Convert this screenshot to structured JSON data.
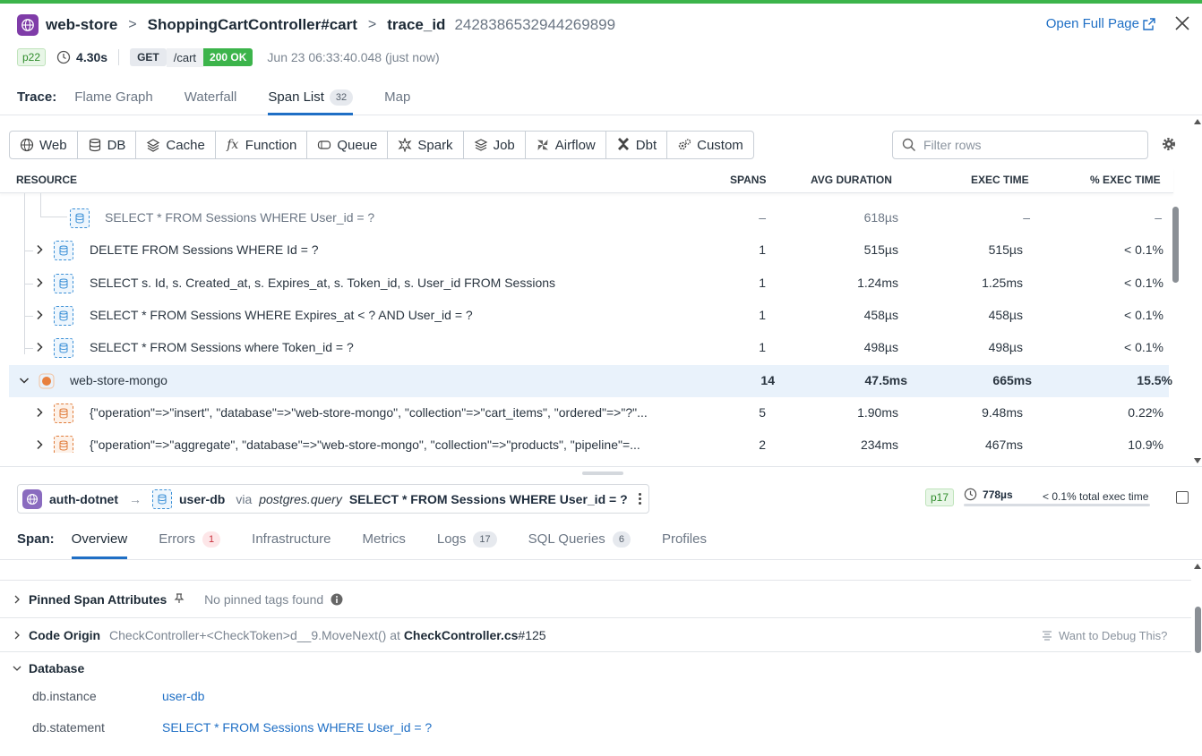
{
  "header": {
    "service": "web-store",
    "resource": "ShoppingCartController#cart",
    "trace_label": "trace_id",
    "trace_id": "2428386532944269899",
    "open_full_page": "Open Full Page",
    "percentile": "p22",
    "duration": "4.30s",
    "method": "GET",
    "path": "/cart",
    "status": "200 OK",
    "timestamp": "Jun 23 06:33:40.048 (just now)"
  },
  "trace_tabs": {
    "label": "Trace:",
    "items": [
      {
        "label": "Flame Graph"
      },
      {
        "label": "Waterfall"
      },
      {
        "label": "Span List",
        "count": "32"
      },
      {
        "label": "Map"
      }
    ]
  },
  "filters": [
    {
      "label": "Web",
      "icon": "globe-icon"
    },
    {
      "label": "DB",
      "icon": "database-icon"
    },
    {
      "label": "Cache",
      "icon": "layers-icon"
    },
    {
      "label": "Function",
      "icon": "function-icon"
    },
    {
      "label": "Queue",
      "icon": "queue-icon"
    },
    {
      "label": "Spark",
      "icon": "spark-icon"
    },
    {
      "label": "Job",
      "icon": "stack-icon"
    },
    {
      "label": "Airflow",
      "icon": "airflow-icon"
    },
    {
      "label": "Dbt",
      "icon": "dbt-icon"
    },
    {
      "label": "Custom",
      "icon": "gears-icon"
    }
  ],
  "search": {
    "placeholder": "Filter rows"
  },
  "table": {
    "headers": {
      "resource": "RESOURCE",
      "spans": "SPANS",
      "avg": "AVG DURATION",
      "exec": "EXEC TIME",
      "pct": "% EXEC TIME"
    },
    "rows": [
      {
        "resource": "SELECT * FROM Sessions WHERE User_id = ?",
        "spans": "–",
        "avg": "618µs",
        "exec": "–",
        "pct": "–"
      },
      {
        "resource": "DELETE FROM Sessions WHERE Id = ?",
        "spans": "1",
        "avg": "515µs",
        "exec": "515µs",
        "pct": "< 0.1%"
      },
      {
        "resource": "SELECT s. Id, s. Created_at, s. Expires_at, s. Token_id, s. User_id FROM Sessions",
        "spans": "1",
        "avg": "1.24ms",
        "exec": "1.25ms",
        "pct": "< 0.1%"
      },
      {
        "resource": "SELECT * FROM Sessions WHERE Expires_at < ? AND User_id = ?",
        "spans": "1",
        "avg": "458µs",
        "exec": "458µs",
        "pct": "< 0.1%"
      },
      {
        "resource": "SELECT * FROM Sessions where Token_id = ?",
        "spans": "1",
        "avg": "498µs",
        "exec": "498µs",
        "pct": "< 0.1%"
      },
      {
        "resource": "web-store-mongo",
        "spans": "14",
        "avg": "47.5ms",
        "exec": "665ms",
        "pct": "15.5%"
      },
      {
        "resource": "{\"operation\"=>\"insert\", \"database\"=>\"web-store-mongo\", \"collection\"=>\"cart_items\", \"ordered\"=>\"?\"...",
        "spans": "5",
        "avg": "1.90ms",
        "exec": "9.48ms",
        "pct": "0.22%"
      },
      {
        "resource": "{\"operation\"=>\"aggregate\", \"database\"=>\"web-store-mongo\", \"collection\"=>\"products\", \"pipeline\"=...",
        "spans": "2",
        "avg": "234ms",
        "exec": "467ms",
        "pct": "10.9%"
      }
    ]
  },
  "span": {
    "service": "auth-dotnet",
    "target": "user-db",
    "via": "via",
    "operation": "postgres.query",
    "resource": "SELECT * FROM Sessions WHERE User_id = ?",
    "percentile": "p17",
    "duration": "778µs",
    "exec_pct": "< 0.1% total exec time"
  },
  "span_tabs": {
    "label": "Span:",
    "items": [
      {
        "label": "Overview"
      },
      {
        "label": "Errors",
        "count": "1"
      },
      {
        "label": "Infrastructure"
      },
      {
        "label": "Metrics"
      },
      {
        "label": "Logs",
        "count": "17"
      },
      {
        "label": "SQL Queries",
        "count": "6"
      },
      {
        "label": "Profiles"
      }
    ]
  },
  "sections": {
    "pinned_title": "Pinned Span Attributes",
    "pinned_empty": "No pinned tags found",
    "code_origin_title": "Code Origin",
    "code_origin_method": "CheckController+<CheckToken>d__9.MoveNext()",
    "code_origin_at": "at",
    "code_origin_file": "CheckController.cs",
    "code_origin_line": "#125",
    "debug_link": "Want to Debug This?",
    "database_title": "Database",
    "db": [
      {
        "key": "db.instance",
        "value": "user-db"
      },
      {
        "key": "db.statement",
        "value": "SELECT * FROM Sessions WHERE User_id = ?"
      }
    ]
  }
}
